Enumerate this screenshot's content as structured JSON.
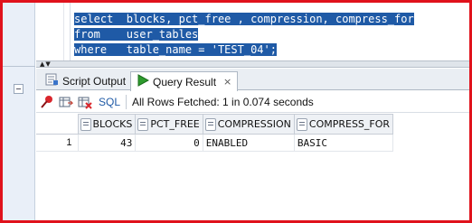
{
  "editor": {
    "lines": [
      {
        "keyword": "select",
        "rest": "  blocks, pct_free , compression, compress_for"
      },
      {
        "keyword": "from",
        "rest": "    user_tables"
      },
      {
        "keyword": "where",
        "rest": "   table_name = 'TEST_04';"
      }
    ]
  },
  "tabs": [
    {
      "label": "Script Output",
      "icon": "script-output-icon"
    },
    {
      "label": "Query Result",
      "icon": "play-icon",
      "active": true
    }
  ],
  "toolbar": {
    "sql_label": "SQL",
    "status": "All Rows Fetched: 1 in 0.074 seconds"
  },
  "grid": {
    "columns": [
      "BLOCKS",
      "PCT_FREE",
      "COMPRESSION",
      "COMPRESS_FOR"
    ],
    "rows": [
      {
        "num": "1",
        "cells": [
          "43",
          "0",
          "ENABLED",
          "BASIC"
        ]
      }
    ]
  },
  "colors": {
    "frame": "#e0121c",
    "selection": "#1f5aa6",
    "tab_play": "#2e9b2e"
  }
}
